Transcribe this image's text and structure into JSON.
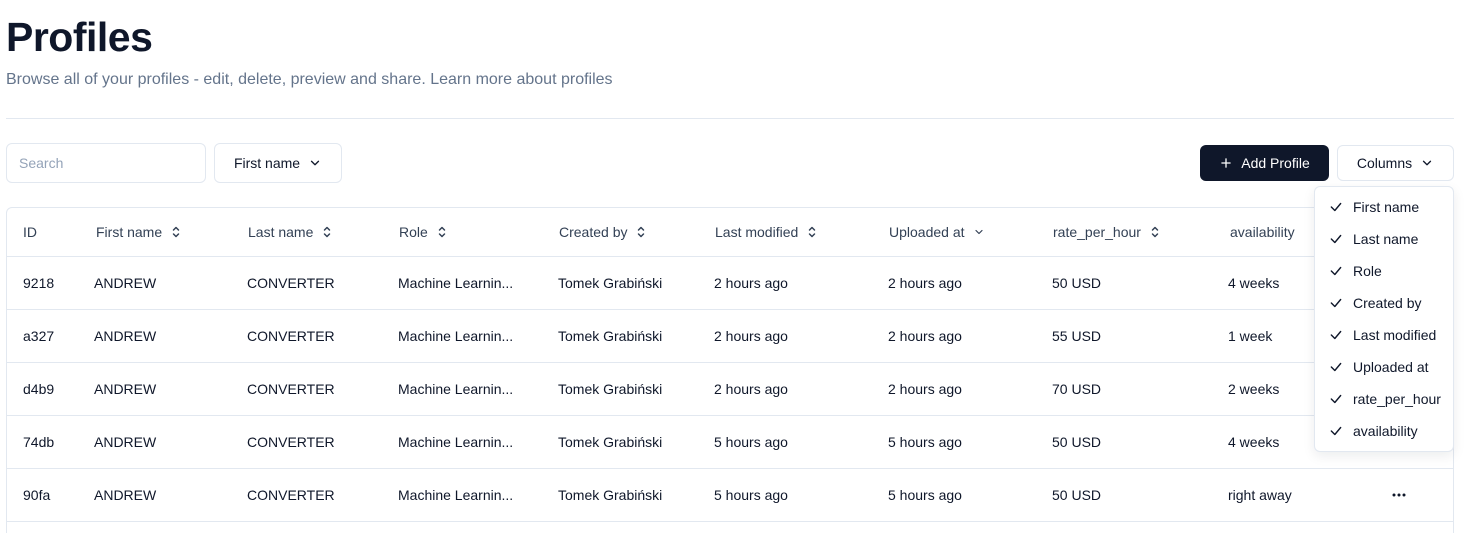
{
  "header": {
    "title": "Profiles",
    "subtitle": "Browse all of your profiles - edit, delete, preview and share. Learn more about profiles"
  },
  "toolbar": {
    "search_placeholder": "Search",
    "filter_label": "First name",
    "add_label": "Add Profile",
    "columns_label": "Columns"
  },
  "table": {
    "columns": [
      {
        "label": "ID",
        "sort": "none"
      },
      {
        "label": "First name",
        "sort": "both"
      },
      {
        "label": "Last name",
        "sort": "both"
      },
      {
        "label": "Role",
        "sort": "both"
      },
      {
        "label": "Created by",
        "sort": "both"
      },
      {
        "label": "Last modified",
        "sort": "both"
      },
      {
        "label": "Uploaded at",
        "sort": "desc"
      },
      {
        "label": "rate_per_hour",
        "sort": "both"
      },
      {
        "label": "availability",
        "sort": "none"
      }
    ],
    "rows": [
      [
        "9218",
        "ANDREW",
        "CONVERTER",
        "Machine Learnin...",
        "Tomek Grabiński",
        "2 hours ago",
        "2 hours ago",
        "50 USD",
        "4 weeks"
      ],
      [
        "a327",
        "ANDREW",
        "CONVERTER",
        "Machine Learnin...",
        "Tomek Grabiński",
        "2 hours ago",
        "2 hours ago",
        "55 USD",
        "1 week"
      ],
      [
        "d4b9",
        "ANDREW",
        "CONVERTER",
        "Machine Learnin...",
        "Tomek Grabiński",
        "2 hours ago",
        "2 hours ago",
        "70 USD",
        "2 weeks"
      ],
      [
        "74db",
        "ANDREW",
        "CONVERTER",
        "Machine Learnin...",
        "Tomek Grabiński",
        "5 hours ago",
        "5 hours ago",
        "50 USD",
        "4 weeks"
      ],
      [
        "90fa",
        "ANDREW",
        "CONVERTER",
        "Machine Learnin...",
        "Tomek Grabiński",
        "5 hours ago",
        "5 hours ago",
        "50 USD",
        "right away"
      ]
    ]
  },
  "columns_menu": {
    "items": [
      {
        "label": "First name",
        "checked": true
      },
      {
        "label": "Last name",
        "checked": true
      },
      {
        "label": "Role",
        "checked": true
      },
      {
        "label": "Created by",
        "checked": true
      },
      {
        "label": "Last modified",
        "checked": true
      },
      {
        "label": "Uploaded at",
        "checked": true
      },
      {
        "label": "rate_per_hour",
        "checked": true
      },
      {
        "label": "availability",
        "checked": true
      }
    ]
  },
  "icons": {
    "filter_chevron": "chevron-down-icon",
    "add": "plus-icon",
    "columns_chevron": "chevron-down-icon",
    "sort_both": "sort-updown-icon",
    "sort_desc": "chevron-down-icon",
    "check": "check-icon",
    "row_actions": "more-horizontal-icon"
  },
  "colors": {
    "primary": "#0f172a",
    "muted_text": "#64748b",
    "border": "#e2e8f0"
  }
}
